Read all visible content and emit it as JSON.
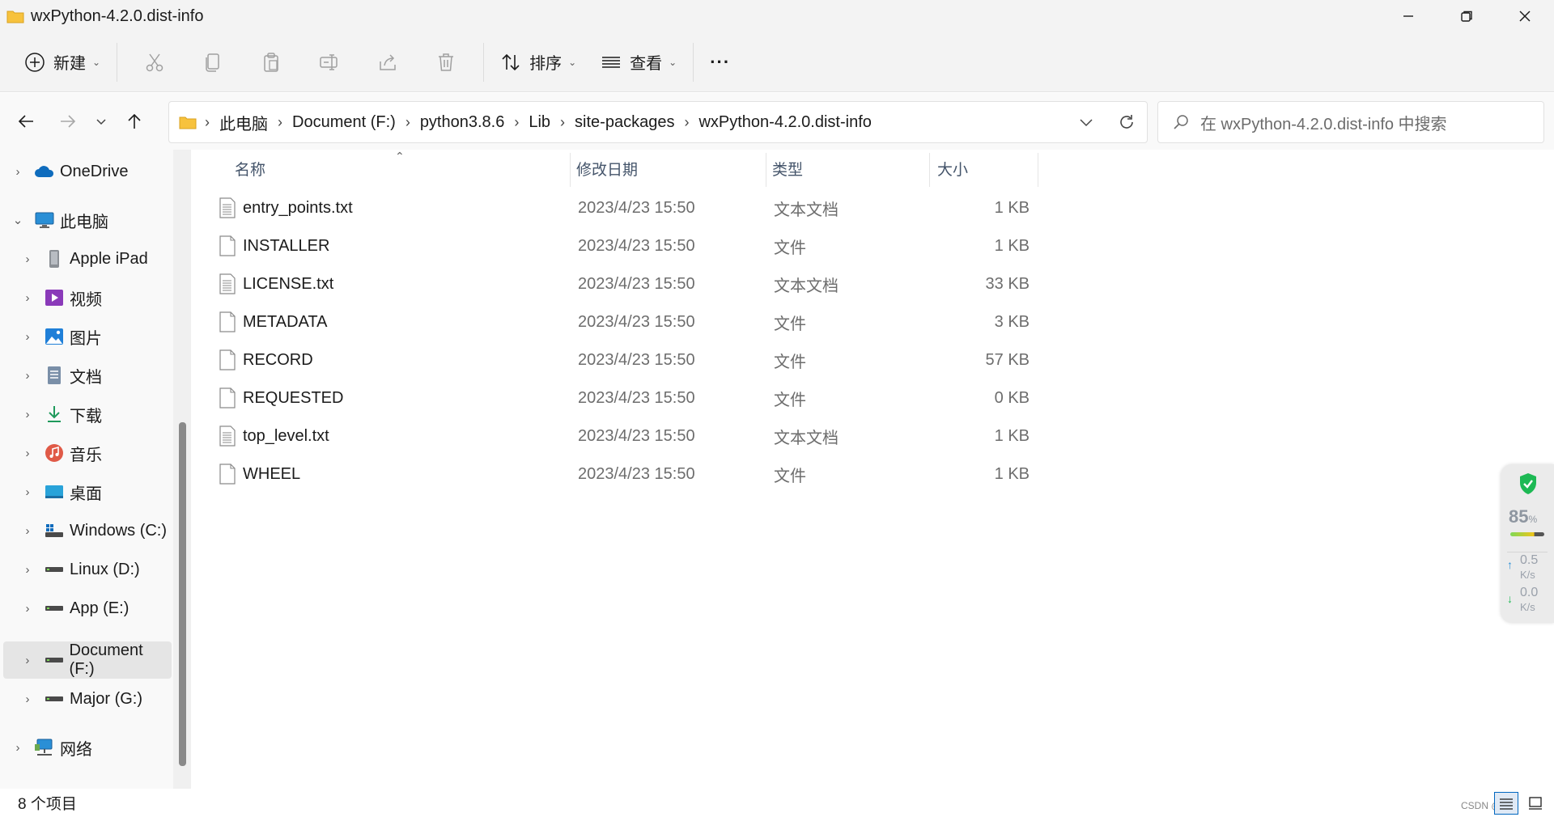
{
  "window": {
    "title": "wxPython-4.2.0.dist-info"
  },
  "toolbar": {
    "new_label": "新建",
    "sort_label": "排序",
    "view_label": "查看",
    "more_label": "···"
  },
  "address": {
    "breadcrumbs": [
      "此电脑",
      "Document (F:)",
      "python3.8.6",
      "Lib",
      "site-packages",
      "wxPython-4.2.0.dist-info"
    ]
  },
  "search": {
    "placeholder": "在 wxPython-4.2.0.dist-info 中搜索"
  },
  "sidebar": {
    "items": [
      {
        "label": "OneDrive",
        "icon": "cloud-icon"
      },
      {
        "label": "此电脑",
        "icon": "computer-icon"
      },
      {
        "label": "Apple iPad",
        "icon": "ipad-icon"
      },
      {
        "label": "视频",
        "icon": "video-icon"
      },
      {
        "label": "图片",
        "icon": "picture-icon"
      },
      {
        "label": "文档",
        "icon": "document-icon"
      },
      {
        "label": "下载",
        "icon": "download-icon"
      },
      {
        "label": "音乐",
        "icon": "music-icon"
      },
      {
        "label": "桌面",
        "icon": "desktop-icon"
      },
      {
        "label": "Windows (C:)",
        "icon": "windows-drive-icon"
      },
      {
        "label": "Linux (D:)",
        "icon": "drive-icon"
      },
      {
        "label": "App (E:)",
        "icon": "drive-icon"
      },
      {
        "label": "Document (F:)",
        "icon": "drive-icon",
        "selected": true
      },
      {
        "label": "Major (G:)",
        "icon": "drive-icon"
      },
      {
        "label": "网络",
        "icon": "network-icon"
      }
    ]
  },
  "filelist": {
    "columns": [
      "名称",
      "修改日期",
      "类型",
      "大小"
    ],
    "rows": [
      {
        "name": "entry_points.txt",
        "date": "2023/4/23 15:50",
        "type": "文本文档",
        "size": "1 KB",
        "icon": "text-file-icon"
      },
      {
        "name": "INSTALLER",
        "date": "2023/4/23 15:50",
        "type": "文件",
        "size": "1 KB",
        "icon": "file-icon"
      },
      {
        "name": "LICENSE.txt",
        "date": "2023/4/23 15:50",
        "type": "文本文档",
        "size": "33 KB",
        "icon": "text-file-icon"
      },
      {
        "name": "METADATA",
        "date": "2023/4/23 15:50",
        "type": "文件",
        "size": "3 KB",
        "icon": "file-icon"
      },
      {
        "name": "RECORD",
        "date": "2023/4/23 15:50",
        "type": "文件",
        "size": "57 KB",
        "icon": "file-icon"
      },
      {
        "name": "REQUESTED",
        "date": "2023/4/23 15:50",
        "type": "文件",
        "size": "0 KB",
        "icon": "file-icon"
      },
      {
        "name": "top_level.txt",
        "date": "2023/4/23 15:50",
        "type": "文本文档",
        "size": "1 KB",
        "icon": "text-file-icon"
      },
      {
        "name": "WHEEL",
        "date": "2023/4/23 15:50",
        "type": "文件",
        "size": "1 KB",
        "icon": "file-icon"
      }
    ]
  },
  "statusbar": {
    "item_count": "8 个项目",
    "watermark": "CSDN @"
  },
  "net_widget": {
    "percent": "85",
    "percent_unit": "%",
    "upload_value": "0.5",
    "upload_unit": "K/s",
    "download_value": "0.0",
    "download_unit": "K/s"
  },
  "colors": {
    "accent": "#0067c0",
    "shield_green": "#1db954",
    "folder_yellow": "#f7c23d"
  }
}
